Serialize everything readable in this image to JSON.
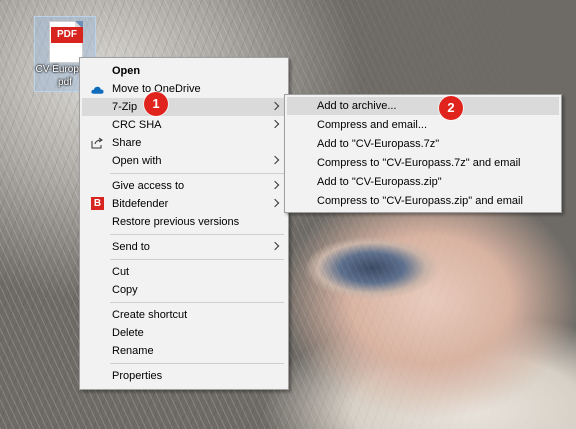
{
  "desktop": {
    "file": {
      "badge": "PDF",
      "name_line1": "CV-Europass",
      "name_line2": "pdf"
    }
  },
  "context_menu": {
    "items": [
      {
        "label": "Open"
      },
      {
        "label": "Move to OneDrive"
      },
      {
        "label": "7-Zip"
      },
      {
        "label": "CRC SHA"
      },
      {
        "label": "Share"
      },
      {
        "label": "Open with"
      },
      {
        "label": "Give access to"
      },
      {
        "label": "Bitdefender",
        "icon_text": "B"
      },
      {
        "label": "Restore previous versions"
      },
      {
        "label": "Send to"
      },
      {
        "label": "Cut"
      },
      {
        "label": "Copy"
      },
      {
        "label": "Create shortcut"
      },
      {
        "label": "Delete"
      },
      {
        "label": "Rename"
      },
      {
        "label": "Properties"
      }
    ]
  },
  "submenu_7zip": {
    "items": [
      {
        "label": "Add to archive..."
      },
      {
        "label": "Compress and email..."
      },
      {
        "label": "Add to \"CV-Europass.7z\""
      },
      {
        "label": "Compress to \"CV-Europass.7z\" and email"
      },
      {
        "label": "Add to \"CV-Europass.zip\""
      },
      {
        "label": "Compress to \"CV-Europass.zip\" and email"
      }
    ]
  },
  "callouts": {
    "step1": "1",
    "step2": "2"
  },
  "colors": {
    "accent_red": "#e0231c",
    "menu_bg": "#f2f2f2",
    "highlight": "#dadada",
    "onedrive_blue": "#0f6cbd"
  }
}
